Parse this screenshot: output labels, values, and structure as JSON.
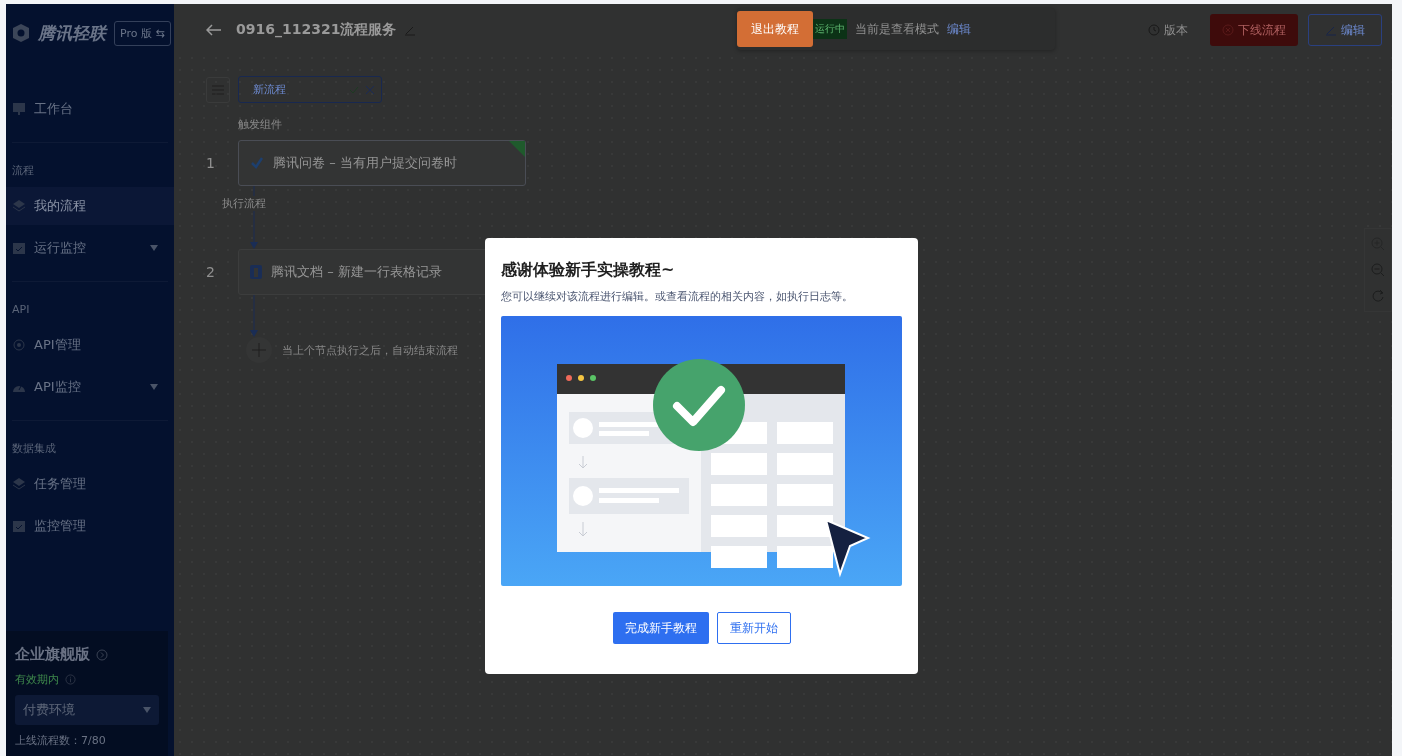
{
  "sidebar": {
    "logo": "腾讯轻联",
    "edition_switch": "Pro 版 ⇆",
    "groups": [
      {
        "items": [
          {
            "label": "工作台",
            "selected": false,
            "expandable": false
          }
        ]
      },
      {
        "label": "流程",
        "items": [
          {
            "label": "我的流程",
            "selected": true,
            "expandable": false
          },
          {
            "label": "运行监控",
            "selected": false,
            "expandable": true
          }
        ]
      },
      {
        "label": "API",
        "items": [
          {
            "label": "API管理",
            "selected": false,
            "expandable": false
          },
          {
            "label": "API监控",
            "selected": false,
            "expandable": true
          }
        ]
      },
      {
        "label": "数据集成",
        "items": [
          {
            "label": "任务管理",
            "selected": false,
            "expandable": false
          },
          {
            "label": "监控管理",
            "selected": false,
            "expandable": false
          }
        ]
      }
    ],
    "plan": {
      "name": "企业旗舰版",
      "validity": "有效期内",
      "environment": "付费环境",
      "quota": "上线流程数：7/80"
    }
  },
  "header": {
    "title": "0916_112321流程服务",
    "tutorial_exit": "退出教程",
    "status_tag": "运行中",
    "mode_text": "当前是查看模式",
    "mode_edit": "编辑",
    "version": "版本",
    "offline": "下线流程",
    "edit": "编辑"
  },
  "flow": {
    "name_value": "新流程",
    "trigger_label": "触发组件",
    "action_label": "执行流程",
    "nodes": [
      {
        "number": "1",
        "label": "腾讯问卷 – 当有用户提交问卷时",
        "selected": true
      },
      {
        "number": "2",
        "label": "腾讯文档 – 新建一行表格记录",
        "selected": false
      }
    ],
    "end_text": "当上个节点执行之后，自动结束流程"
  },
  "modal": {
    "title": "感谢体验新手实操教程~",
    "subtitle": "您可以继续对该流程进行编辑。或查看流程的相关内容，如执行日志等。",
    "primary": "完成新手教程",
    "secondary": "重新开始"
  }
}
